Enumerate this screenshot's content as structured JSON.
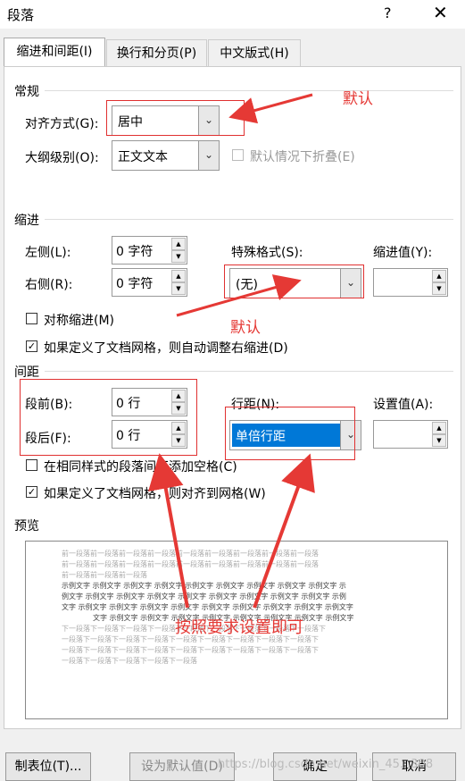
{
  "window": {
    "title": "段落",
    "help_icon": "?",
    "close_icon": "✕"
  },
  "tabs": [
    {
      "label": "缩进和间距(I)",
      "active": true
    },
    {
      "label": "换行和分页(P)",
      "active": false
    },
    {
      "label": "中文版式(H)",
      "active": false
    }
  ],
  "general": {
    "heading": "常规",
    "align_label": "对齐方式(G):",
    "align_value": "居中",
    "outline_label": "大纲级别(O):",
    "outline_value": "正文文本",
    "collapse_label": "默认情况下折叠(E)"
  },
  "indent": {
    "heading": "缩进",
    "left_label": "左侧(L):",
    "left_value": "0 字符",
    "right_label": "右侧(R):",
    "right_value": "0 字符",
    "special_label": "特殊格式(S):",
    "special_value": "(无)",
    "by_label": "缩进值(Y):",
    "by_value": "",
    "mirror_label": "对称缩进(M)",
    "mirror_checked": false,
    "auto_adjust_label": "如果定义了文档网格，则自动调整右缩进(D)",
    "auto_adjust_checked": true
  },
  "spacing": {
    "heading": "间距",
    "before_label": "段前(B):",
    "before_value": "0 行",
    "after_label": "段后(F):",
    "after_value": "0 行",
    "line_label": "行距(N):",
    "line_value": "单倍行距",
    "at_label": "设置值(A):",
    "at_value": "",
    "no_space_label": "在相同样式的段落间不添加空格(C)",
    "no_space_checked": false,
    "snap_grid_label": "如果定义了文档网格，则对齐到网格(W)",
    "snap_grid_checked": true
  },
  "preview": {
    "heading": "预览",
    "prev_lines": [
      "前一段落前一段落前一段落前一段落前一段落前一段落前一段落前一段落前一段落",
      "前一段落前一段落前一段落前一段落前一段落前一段落前一段落前一段落前一段落",
      "前一段落前一段落前一段落"
    ],
    "sample_lines": [
      "示例文字  示例文字  示例文字  示例文字  示例文字  示例文字  示例文字  示例文字  示例文字  示",
      "例文字  示例文字  示例文字  示例文字  示例文字  示例文字  示例文字  示例文字  示例文字  示例",
      "文字  示例文字  示例文字  示例文字  示例文字  示例文字  示例文字  示例文字  示例文字  示例文字",
      "文字  示例文字  示例文字  示例文字  示例文字  示例文字  示例文字  示例文字  示例文字"
    ],
    "next_lines": [
      "下一段落下一段落下一段落下一段落下一段落下一段落下一段落下一段落下一段落下",
      "一段落下一段落下一段落下一段落下一段落下一段落下一段落下一段落下一段落下",
      "一段落下一段落下一段落下一段落下一段落下一段落下一段落下一段落下一段落下",
      "一段落下一段落下一段落下一段落下一段落"
    ]
  },
  "buttons": {
    "tabs": "制表位(T)...",
    "set_default": "设为默认值(D)",
    "ok": "确定",
    "cancel": "取消"
  },
  "annotations": {
    "default1": "默认",
    "default2": "默认",
    "instruction": "按照要求设置即可",
    "color": "#e53935"
  },
  "watermark": "https://blog.csdn.net/weixin_45...308"
}
